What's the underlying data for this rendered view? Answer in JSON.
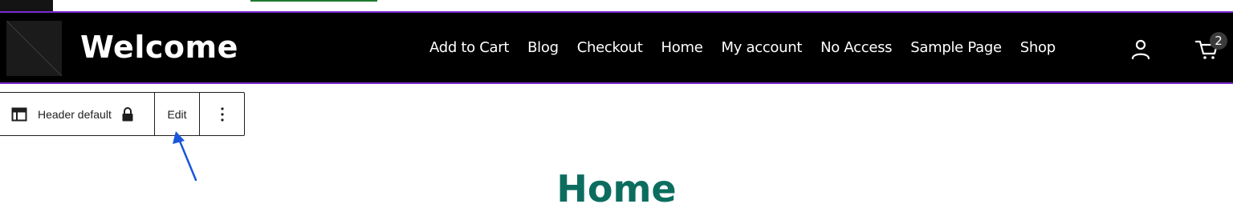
{
  "header": {
    "site_title": "Welcome",
    "nav": [
      "Add to Cart",
      "Blog",
      "Checkout",
      "Home",
      "My account",
      "No Access",
      "Sample Page",
      "Shop"
    ],
    "cart_count": "2",
    "account_icon": "user-icon",
    "cart_icon": "cart-icon",
    "colors": {
      "background": "#000000",
      "border": "#7b2bd0",
      "text": "#ffffff"
    }
  },
  "toolbar": {
    "template_icon": "layout-icon",
    "part_label": "Header default",
    "lock_icon": "lock-icon",
    "edit_label": "Edit",
    "more_icon": "more-vertical-icon"
  },
  "annotation": {
    "arrow_icon": "arrow-icon",
    "color": "#1a56db"
  },
  "main": {
    "heading": "Home",
    "heading_color": "#0c6d5f"
  }
}
